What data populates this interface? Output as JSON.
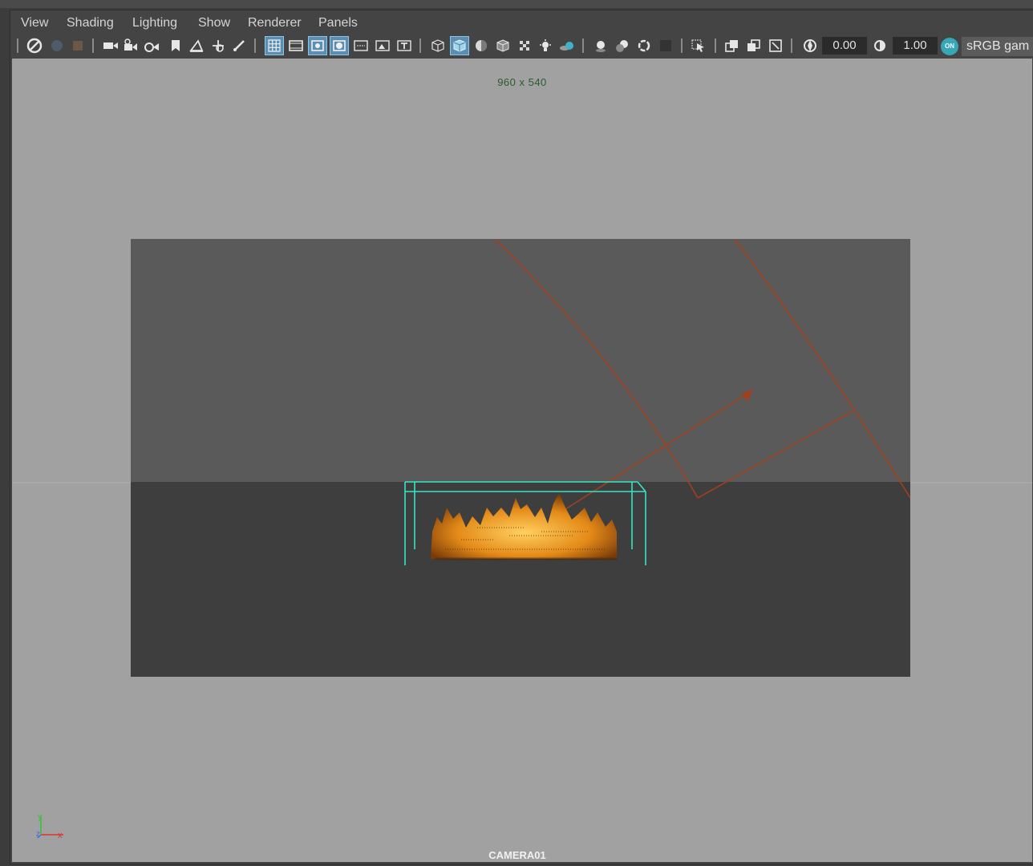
{
  "menu": {
    "view": "View",
    "shading": "Shading",
    "lighting": "Lighting",
    "show": "Show",
    "renderer": "Renderer",
    "panels": "Panels"
  },
  "toolbar": {
    "exposure_value": "0.00",
    "gamma_value": "1.00",
    "color_mgmt_toggle": "ON",
    "color_space": "sRGB gam",
    "icons": [
      "select-camera-icon",
      "camera-icon",
      "camera-attributes-icon",
      "bookmark-icon",
      "image-plane-icon",
      "grid-icon",
      "film-gate-icon",
      "resolution-gate-icon",
      "gate-mask-icon",
      "field-chart-icon",
      "safe-action-icon",
      "safe-title-icon",
      "wireframe-icon",
      "smooth-shade-icon",
      "default-material-icon",
      "xray-icon",
      "textured-icon",
      "use-all-lights-icon",
      "shadows-icon",
      "screen-space-ao-icon",
      "motion-blur-icon",
      "anti-aliasing-icon",
      "depth-of-field-icon",
      "isolate-select-icon",
      "xray-joints-icon",
      "xray-active-icon",
      "backface-culling-icon",
      "exposure-icon",
      "gamma-icon",
      "color-management-icon"
    ]
  },
  "viewport": {
    "resolution_label": "960 x 540",
    "camera_label": "CAMERA01",
    "colors": {
      "background": "#a1a1a1",
      "sky": "#5a5a5a",
      "ground": "#3e3e3e",
      "container": "#32e6c8",
      "light": "#a0401c",
      "fire": "#f5a020",
      "axis_x": "#e33030",
      "axis_y": "#36c236",
      "axis_z": "#3a6de0"
    }
  }
}
